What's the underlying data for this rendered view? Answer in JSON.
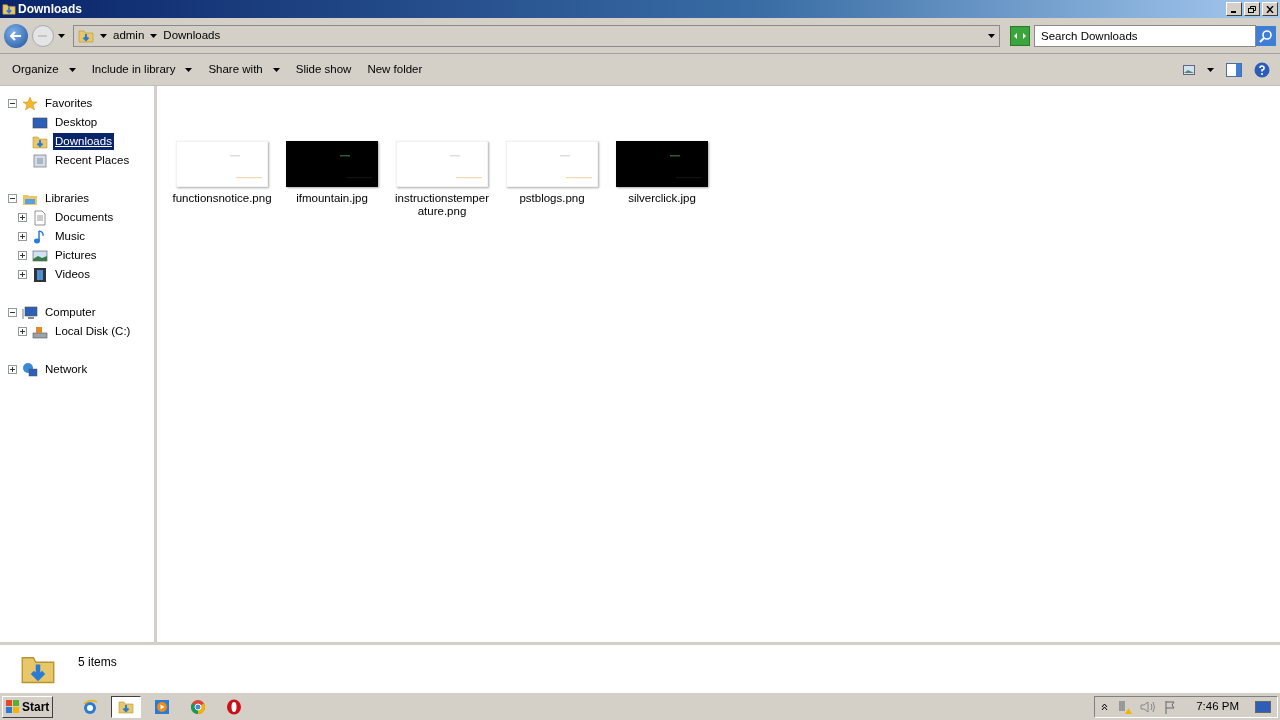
{
  "window": {
    "title": "Downloads"
  },
  "address": {
    "crumbs": [
      "admin",
      "Downloads"
    ]
  },
  "search": {
    "placeholder": "Search Downloads"
  },
  "toolbar": [
    {
      "label": "Organize",
      "dropdown": true
    },
    {
      "label": "Include in library",
      "dropdown": true
    },
    {
      "label": "Share with",
      "dropdown": true
    },
    {
      "label": "Slide show",
      "dropdown": false
    },
    {
      "label": "New folder",
      "dropdown": false
    }
  ],
  "sidebar": [
    {
      "label": "Favorites",
      "kind": "star",
      "expanded": true,
      "selected": false,
      "children": [
        {
          "label": "Desktop",
          "kind": "desktop",
          "selected": false
        },
        {
          "label": "Downloads",
          "kind": "downloads",
          "selected": true
        },
        {
          "label": "Recent Places",
          "kind": "recent",
          "selected": false
        }
      ]
    },
    {
      "label": "Libraries",
      "kind": "library",
      "expanded": true,
      "selected": false,
      "children": [
        {
          "label": "Documents",
          "kind": "document",
          "expanded": false,
          "selected": false
        },
        {
          "label": "Music",
          "kind": "music",
          "expanded": false,
          "selected": false
        },
        {
          "label": "Pictures",
          "kind": "pictures",
          "expanded": false,
          "selected": false
        },
        {
          "label": "Videos",
          "kind": "videos",
          "expanded": false,
          "selected": false
        }
      ]
    },
    {
      "label": "Computer",
      "kind": "computer",
      "expanded": true,
      "selected": false,
      "children": [
        {
          "label": "Local Disk (C:)",
          "kind": "disk",
          "expanded": false,
          "selected": false
        }
      ]
    },
    {
      "label": "Network",
      "kind": "network",
      "expanded": false,
      "selected": false
    }
  ],
  "files": [
    {
      "name": "functionsnotice.png",
      "kind": "light"
    },
    {
      "name": "ifmountain.jpg",
      "kind": "dark"
    },
    {
      "name": "instructionstemperature.png",
      "kind": "light"
    },
    {
      "name": "pstblogs.png",
      "kind": "light"
    },
    {
      "name": "silverclick.jpg",
      "kind": "dark"
    }
  ],
  "details": {
    "count": "5 items"
  },
  "taskbar": {
    "start": "Start",
    "apps": [
      {
        "kind": "ie",
        "selected": false
      },
      {
        "kind": "explorer",
        "selected": true
      },
      {
        "kind": "media",
        "selected": false
      },
      {
        "kind": "chrome",
        "selected": false
      },
      {
        "kind": "opera",
        "selected": false
      }
    ],
    "clock": "7:46 PM"
  }
}
